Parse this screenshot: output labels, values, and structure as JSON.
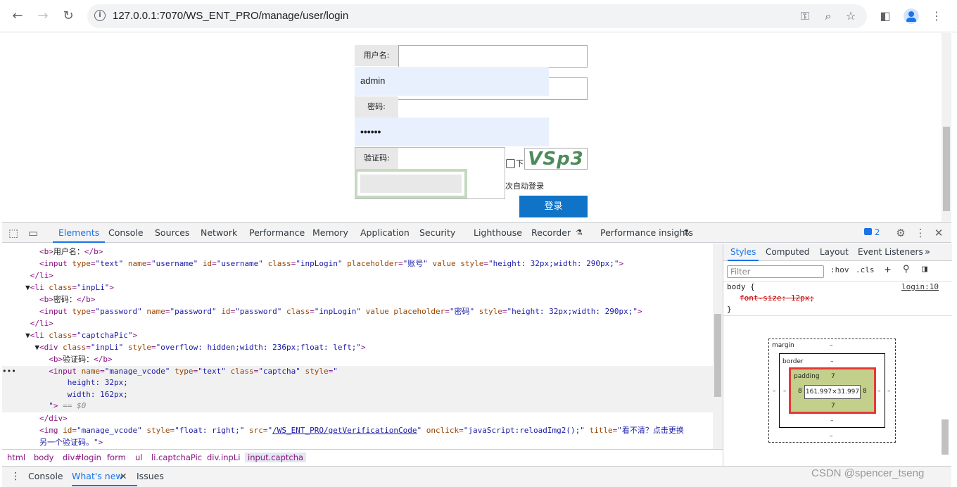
{
  "browser": {
    "url": "127.0.0.1:7070/WS_ENT_PRO/manage/user/login"
  },
  "page": {
    "username_label": "用户名:",
    "username_autofill": "admin",
    "password_label": "密码:",
    "password_autofill": "••••••",
    "captcha_label": "验证码:",
    "captcha_text": "VSp3",
    "remember_label_1": "下",
    "remember_label_2": "次自动登录",
    "login_button": "登录"
  },
  "devtools": {
    "tabs": [
      "Elements",
      "Console",
      "Sources",
      "Network",
      "Performance",
      "Memory",
      "Application",
      "Security",
      "Lighthouse",
      "Recorder",
      "Performance insights"
    ],
    "issues_badge": "2",
    "breadcrumb": [
      "html",
      "body",
      "div#login",
      "form",
      "ul",
      "li.captchaPic",
      "div.inpLi",
      "input.captcha"
    ],
    "styles_tabs": [
      "Styles",
      "Computed",
      "Layout",
      "Event Listeners"
    ],
    "filter_placeholder": "Filter",
    "hov": ":hov",
    "cls": ".cls",
    "rule_selector": "body {",
    "rule_source": "login:10",
    "rule_prop": "font-size: 12px;",
    "rule_close": "}",
    "box_model": {
      "margin_label": "margin",
      "border_label": "border",
      "padding_label": "padding",
      "dash": "–",
      "padding_top": "7",
      "padding_bottom": "7",
      "padding_left": "8",
      "padding_right": "8",
      "content_size": "161.997×31.997"
    },
    "bottom_tabs": [
      "Console",
      "What's new",
      "Issues"
    ]
  },
  "watermark": "CSDN @spencer_tseng"
}
